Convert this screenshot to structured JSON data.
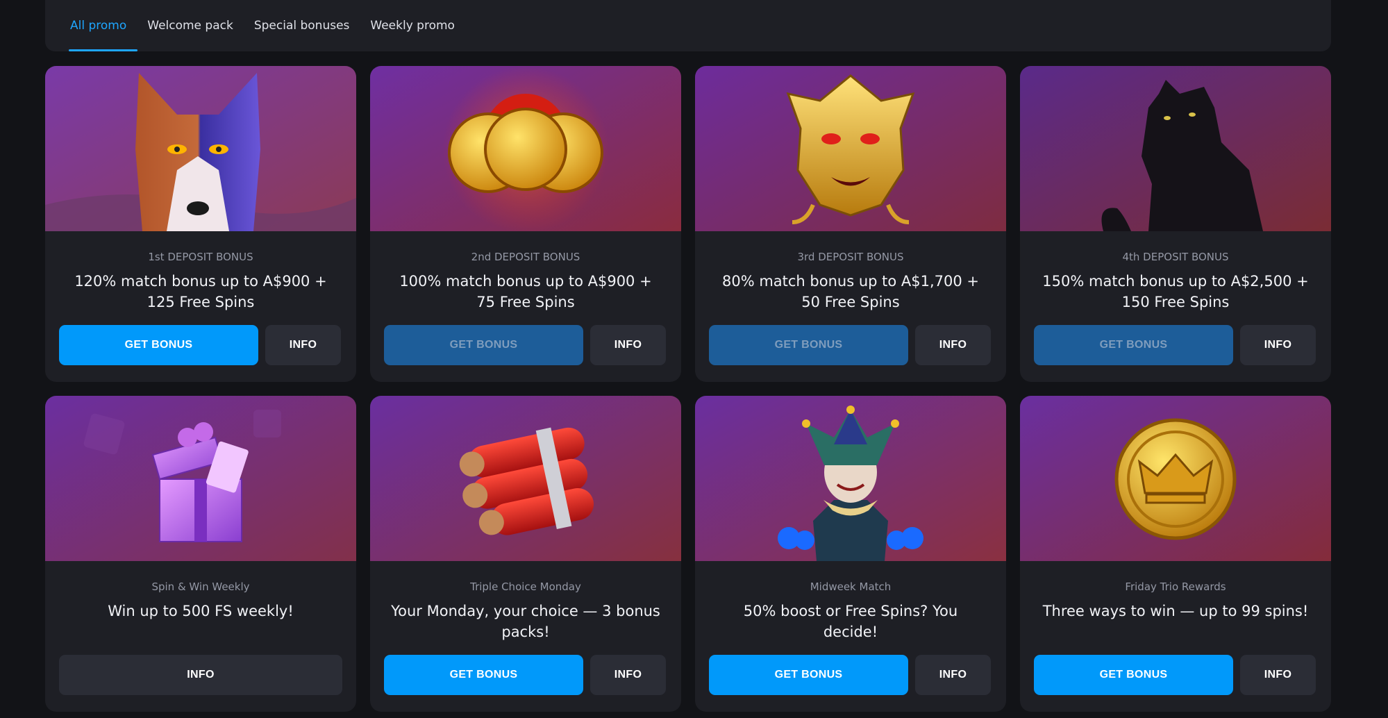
{
  "tabs": [
    {
      "label": "All promo",
      "active": true
    },
    {
      "label": "Welcome pack"
    },
    {
      "label": "Special bonuses"
    },
    {
      "label": "Weekly promo"
    }
  ],
  "cards": [
    {
      "image": "wolf",
      "caption": "1st DEPOSIT BONUS",
      "title": "120% match bonus up to A$900 + 125 Free Spins",
      "get_label": "GET BONUS",
      "info_label": "INFO"
    },
    {
      "image": "red-coins",
      "caption": "2nd DEPOSIT BONUS",
      "title": "100% match bonus up to A$900 + 75 Free Spins",
      "get_label": "GET BONUS",
      "info_label": "INFO"
    },
    {
      "image": "golden-dragon-mask",
      "caption": "3rd DEPOSIT BONUS",
      "title": "80% match bonus up to A$1,700 + 50 Free Spins",
      "get_label": "GET BONUS",
      "info_label": "INFO"
    },
    {
      "image": "black-panther",
      "caption": "4th DEPOSIT BONUS",
      "title": "150% match bonus up to A$2,500 + 150 Free Spins",
      "get_label": "GET BONUS",
      "info_label": "INFO"
    },
    {
      "image": "gift-box",
      "caption": "Spin & Win Weekly",
      "title": "Win up to 500 FS weekly!",
      "info_label": "INFO"
    },
    {
      "image": "dynamite",
      "caption": "Triple Choice Monday",
      "title": "Your Monday, your choice — 3 bonus packs!",
      "get_label": "GET BONUS",
      "info_label": "INFO"
    },
    {
      "image": "jester",
      "caption": "Midweek Match",
      "title": "50% boost or Free Spins? You decide!",
      "get_label": "GET BONUS",
      "info_label": "INFO"
    },
    {
      "image": "crown-coin",
      "caption": "Friday Trio Rewards",
      "title": "Three ways to win — up to 99 spins!",
      "get_label": "GET BONUS",
      "info_label": "INFO"
    }
  ],
  "colors": {
    "accent": "#0199fa",
    "card_bg": "#1e1f25",
    "page_bg": "#121317",
    "tab_active": "#1ea6ff"
  }
}
